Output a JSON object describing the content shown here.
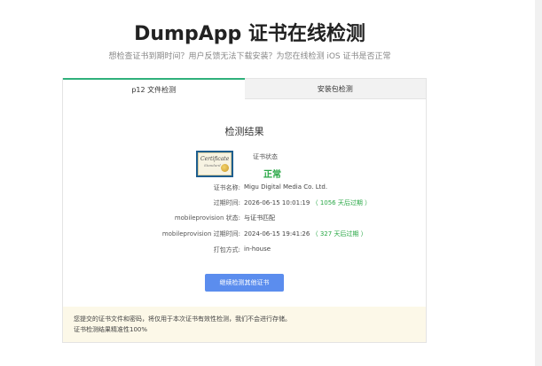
{
  "header": {
    "title": "DumpApp 证书在线检测",
    "subtitle": "想检查证书到期时间？用户反馈无法下载安装？为您在线检测 iOS 证书是否正常"
  },
  "tabs": [
    {
      "label": "p12 文件检测",
      "active": true
    },
    {
      "label": "安装包检测",
      "active": false
    }
  ],
  "result": {
    "title": "检测结果",
    "status_label": "证书状态",
    "status_value": "正常",
    "rows": [
      {
        "label": "证书名称:",
        "value": "Migu Digital Media Co. Ltd.",
        "extra": ""
      },
      {
        "label": "过期时间:",
        "value": "2026-06-15 10:01:19",
        "extra": "（ 1056 天后过期 ）"
      },
      {
        "label": "mobileprovision 状态:",
        "value": "",
        "extra": "与证书匹配"
      },
      {
        "label": "mobileprovision 过期时间:",
        "value": "2024-06-15 19:41:26",
        "extra": "（ 327 天后过期 ）"
      },
      {
        "label": "打包方式:",
        "value": "in-house",
        "extra": ""
      }
    ]
  },
  "button": {
    "label": "继续检测其他证书"
  },
  "notice": {
    "line1": "您提交的证书文件和密码，将仅用于本次证书有效性检测，我们不会进行存储。",
    "line2": "证书检测结果精准性100%"
  },
  "certificate_image": {
    "title": "Certificate",
    "subtitle": "Standard",
    "icon": "certificate-icon"
  },
  "colors": {
    "accent": "#2fb07b",
    "ok": "#28a745",
    "button": "#5b8dee",
    "notice_bg": "#fcf8e8"
  }
}
